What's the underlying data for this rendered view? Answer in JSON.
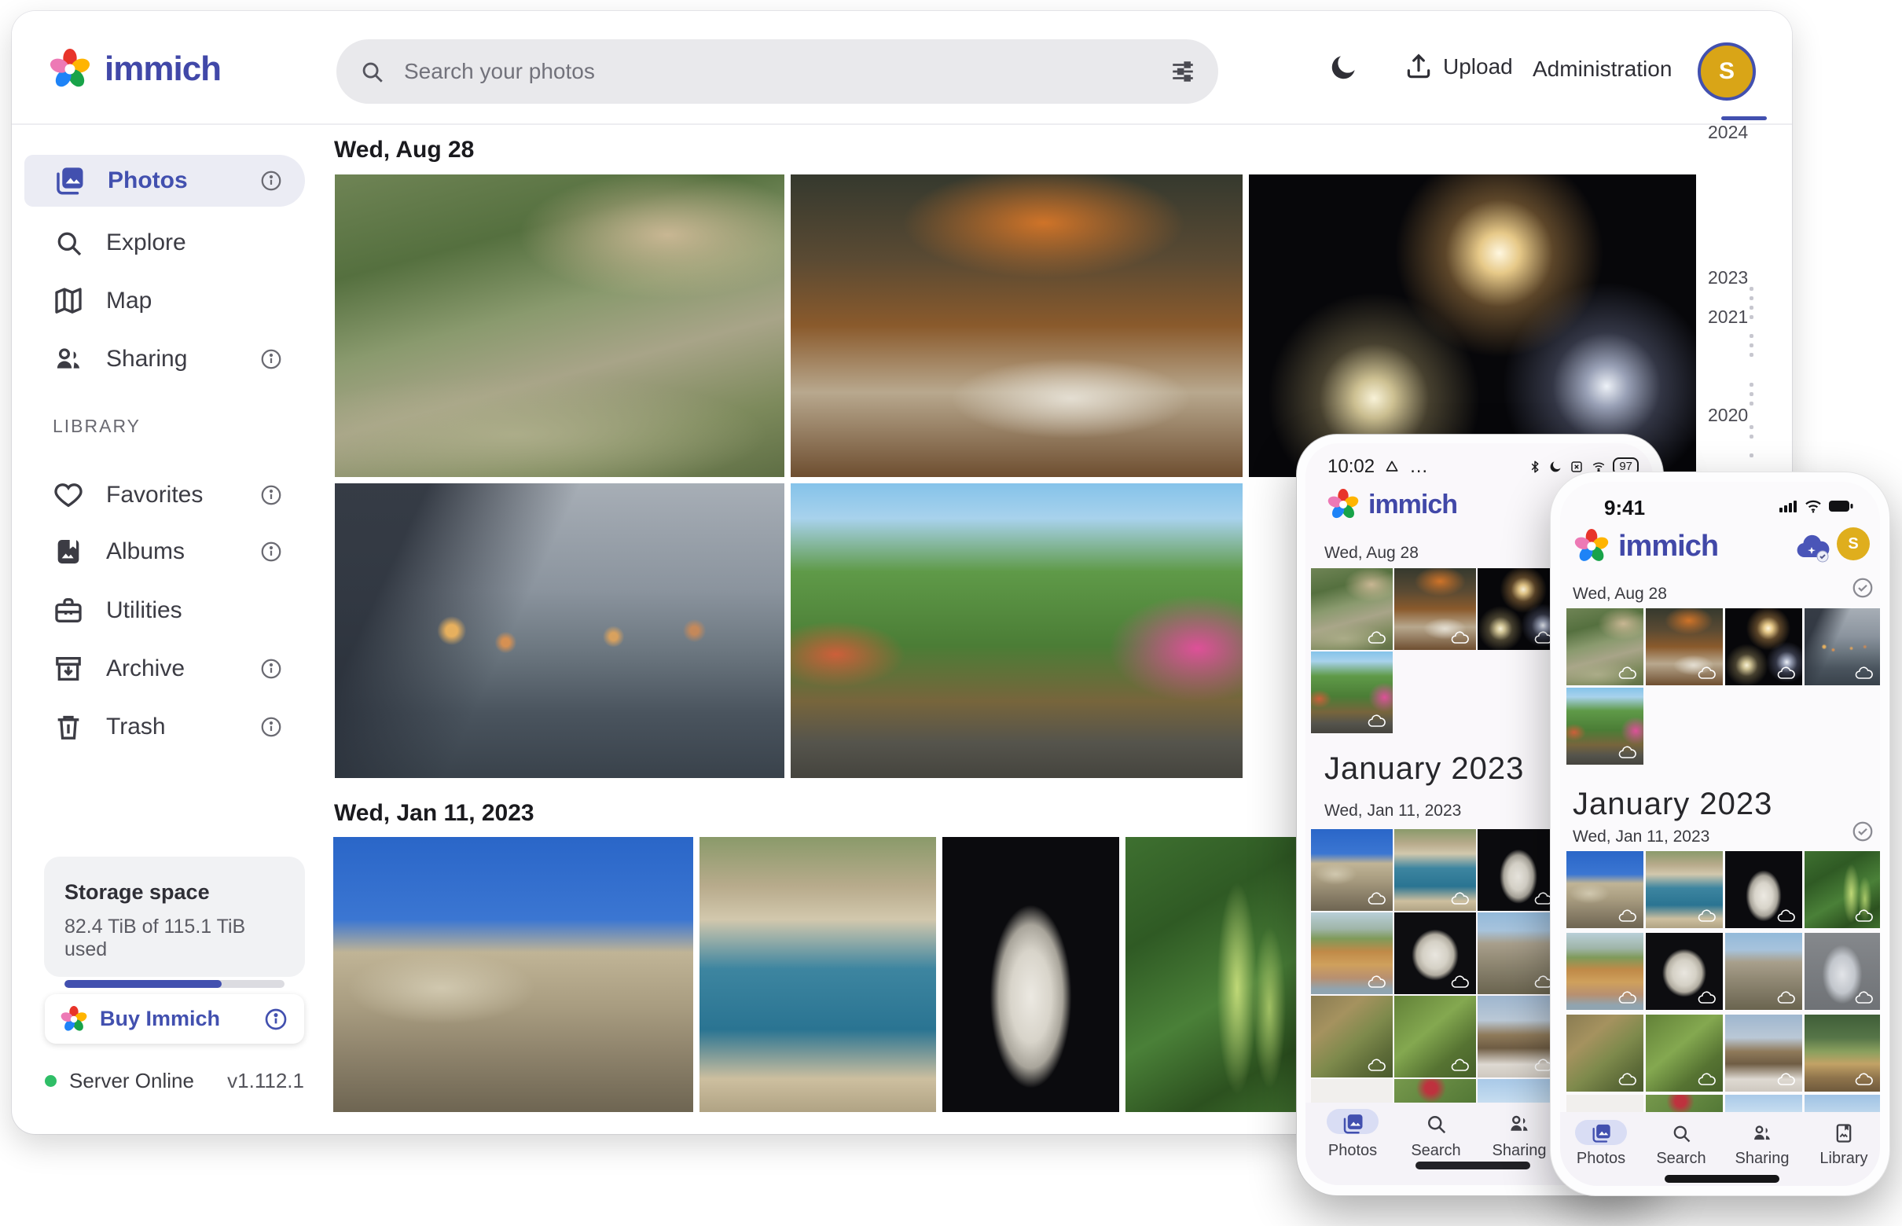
{
  "brand": {
    "name": "immich",
    "accent": "#4250af",
    "avatar_bg": "#d9a517"
  },
  "topbar": {
    "search_placeholder": "Search your photos",
    "upload": "Upload",
    "administration": "Administration",
    "avatar_initial": "S"
  },
  "sidebar": {
    "nav": [
      {
        "label": "Photos"
      },
      {
        "label": "Explore"
      },
      {
        "label": "Map"
      },
      {
        "label": "Sharing"
      }
    ],
    "section": "LIBRARY",
    "library": [
      {
        "label": "Favorites"
      },
      {
        "label": "Albums"
      },
      {
        "label": "Utilities"
      },
      {
        "label": "Archive"
      },
      {
        "label": "Trash"
      }
    ],
    "storage": {
      "title": "Storage space",
      "usage": "82.4 TiB of 115.1 TiB used",
      "percent_used": 71.6
    },
    "buy_label": "Buy Immich",
    "server": {
      "status": "Server Online",
      "version": "v1.112.1",
      "status_color": "#2fbe67"
    }
  },
  "timeline": {
    "section1_date": "Wed, Aug 28",
    "section2_date": "Wed, Jan 11, 2023"
  },
  "scrubber": {
    "years": [
      "2024",
      "2023",
      "2021",
      "2020"
    ]
  },
  "phone_android": {
    "clock": "10:02",
    "battery": "97",
    "section1_date": "Wed, Aug 28",
    "month_header": "January 2023",
    "section2_date": "Wed, Jan 11, 2023",
    "nav": [
      "Photos",
      "Search",
      "Sharing"
    ]
  },
  "phone_ios": {
    "clock": "9:41",
    "avatar_initial": "S",
    "section1_date": "Wed, Aug 28",
    "month_header": "January 2023",
    "section2_date": "Wed, Jan 11, 2023",
    "nav": [
      "Photos",
      "Search",
      "Sharing",
      "Library"
    ]
  }
}
